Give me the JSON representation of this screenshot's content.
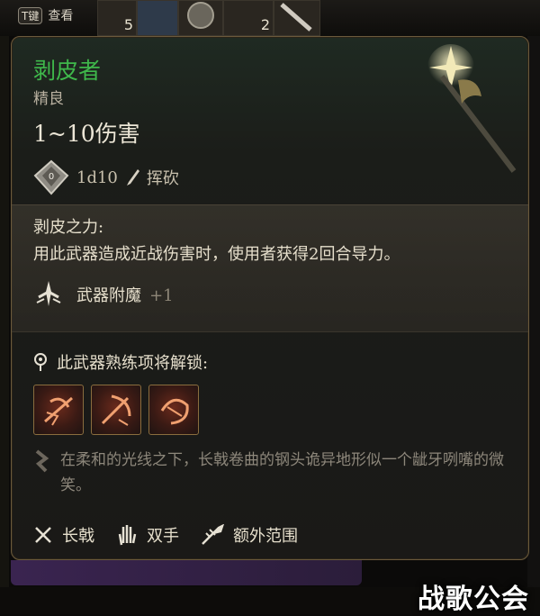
{
  "hotbar": {
    "key": "T键",
    "key_label": "查看",
    "slot_counts": [
      "5",
      "2"
    ]
  },
  "item": {
    "name": "剥皮者",
    "rarity": "精良",
    "damage": "1~10伤害",
    "dice": "1d10",
    "attack_type": "挥砍",
    "ability_title": "剥皮之力:",
    "ability_desc": "用此武器造成近战伤害时，使用者获得2回合导力。",
    "enchant_label": "武器附魔",
    "enchant_value": "+1",
    "proficiency_label": "此武器熟练项将解锁:",
    "flavor": "在柔和的光线之下，长戟卷曲的钢头诡异地形似一个龇牙咧嘴的微笑。",
    "properties": [
      {
        "label": "长戟",
        "icon": "halberd-icon"
      },
      {
        "label": "双手",
        "icon": "hand-icon"
      },
      {
        "label": "额外范围",
        "icon": "reach-icon"
      }
    ]
  },
  "colors": {
    "rarity_green": "#3fb84b",
    "panel_border": "#6b5a3c",
    "text_main": "#e6dfcc",
    "text_muted": "#8d877b"
  },
  "watermark": "战歌公会"
}
